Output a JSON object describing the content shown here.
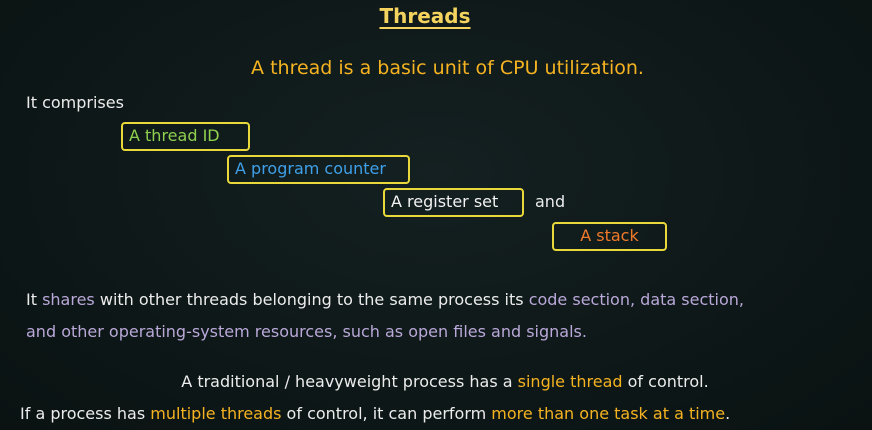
{
  "slide": {
    "title": "Threads",
    "tagline": "A thread is a basic unit of CPU utilization.",
    "comprises_label": "It comprises",
    "components": [
      "A thread ID",
      "A program counter",
      "A register set",
      "A stack"
    ],
    "connector_and": "and",
    "shares": {
      "line1_a": "It ",
      "line1_b": "shares",
      "line1_c": " with other threads belonging to the same process its ",
      "line1_d": "code section, data section,",
      "line2_a": "and other operating-system resources",
      "line2_b": ", such as open files and signals."
    },
    "traditional": {
      "a": "A traditional / heavyweight process has a ",
      "b": "single thread",
      "c": " of control."
    },
    "multiple": {
      "a": "If a process has ",
      "b": "multiple threads",
      "c": " of control, it can perform ",
      "d": "more than one task at a time",
      "e": "."
    },
    "colors": {
      "background": "#0d1616",
      "title": "#f4d35e",
      "tagline": "#f5b321",
      "box_border": "#e8d83a",
      "thread_id": "#8fd14f",
      "program_counter": "#3fa0e8",
      "register_set": "#f2f2f2",
      "stack": "#f07a2a",
      "highlight_lavender": "#b9a8d8",
      "highlight_gold": "#f5b321"
    }
  }
}
